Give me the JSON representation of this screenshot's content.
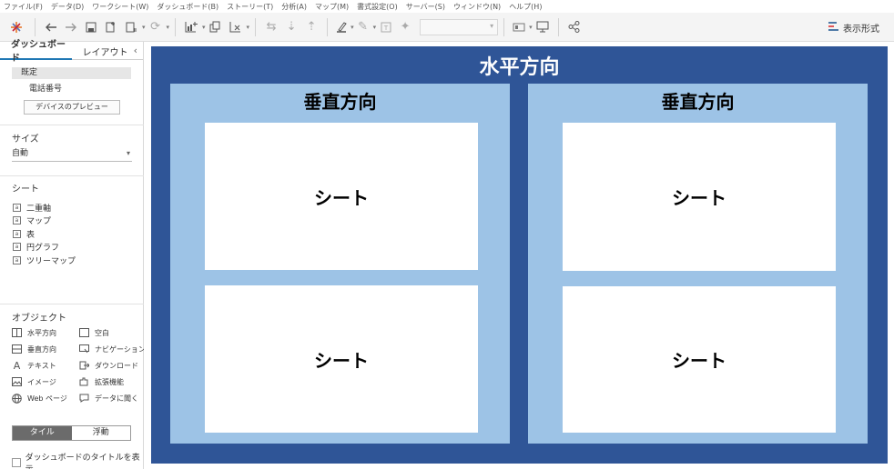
{
  "menu": [
    "ファイル(F)",
    "データ(D)",
    "ワークシート(W)",
    "ダッシュボード(B)",
    "ストーリー(T)",
    "分析(A)",
    "マップ(M)",
    "書式設定(O)",
    "サーバー(S)",
    "ウィンドウ(N)",
    "ヘルプ(H)"
  ],
  "toolbar": {
    "show_me_label": "表示形式"
  },
  "left_panel": {
    "tabs": [
      "ダッシュボード",
      "レイアウト"
    ],
    "collapse_glyph": "‹",
    "device": {
      "default_label": "既定",
      "phone_label": "電話番号",
      "preview_button": "デバイスのプレビュー"
    },
    "size": {
      "title": "サイズ",
      "value": "自動"
    },
    "sheets": {
      "title": "シート",
      "items": [
        "二重軸",
        "マップ",
        "表",
        "円グラフ",
        "ツリーマップ"
      ]
    },
    "objects": {
      "title": "オブジェクト",
      "items": [
        "水平方向",
        "空白",
        "垂直方向",
        "ナビゲーション",
        "テキスト",
        "ダウンロード",
        "イメージ",
        "拡張機能",
        "Web ページ",
        "データに聞く"
      ]
    },
    "layout_toggle": [
      "タイル",
      "浮動"
    ],
    "show_title_checkbox": "ダッシュボードのタイトルを表示"
  },
  "dashboard": {
    "horizontal_title": "水平方向",
    "vertical_title": "垂直方向",
    "sheet_label": "シート",
    "colors": {
      "horizontal": "#2f5597",
      "vertical": "#9dc3e6"
    }
  }
}
